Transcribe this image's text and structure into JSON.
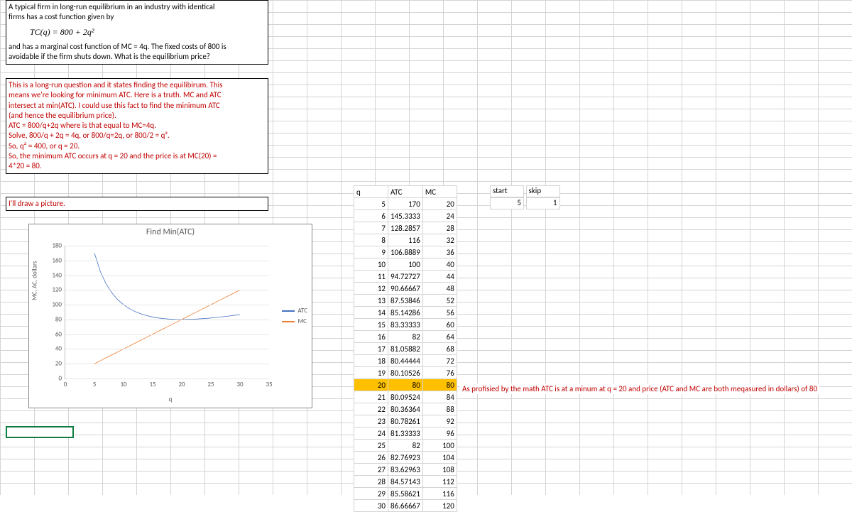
{
  "problem": {
    "line1": "A typical firm in long-run equilibrium in an industry with identical",
    "line2": "firms has a cost function given by",
    "formula": "TC(q) = 800 + 2q²",
    "line3": "and has a marginal cost function of MC = 4q. The fixed costs of 800 is",
    "line4": "avoidable if the firm shuts down. What is the equilibrium price?"
  },
  "solution": {
    "l1": "This is a long-run question and it states finding the equilibirum. This",
    "l2": "means we're looking for minimum ATC. Here is a truth. MC and ATC",
    "l3": "intersect at min(ATC). I could use this fact to find the minimum ATC",
    "l4": "(and hence the equilibrium price).",
    "l5": "ATC = 800/q+2q where is that equal to MC=4q.",
    "l6": "Solve, 800/q + 2q = 4q, or 800/q=2q, or 800/2 = q².",
    "l7": "So, q² = 400, or q = 20.",
    "l8": "So, the minimum ATC occurs at q = 20 and the price is at MC(20) =",
    "l9": "4*20 = 80."
  },
  "picture_note": "I'll draw a picture.",
  "annotation": "As profisied by the math ATC is at a minum at q = 20 and price (ATC and MC are both meqasured in dollars) of 80",
  "chart_title": "Find Min(ATC)",
  "legend": {
    "atc": "ATC",
    "mc": "MC"
  },
  "axes": {
    "y": "MC, AC, dollars",
    "x": "q"
  },
  "headers": {
    "q": "q",
    "atc": "ATC",
    "mc": "MC",
    "start": "start",
    "skip": "skip"
  },
  "start_val": "5",
  "skip_val": "1",
  "highlight_q": 20,
  "colors": {
    "atc": "#4472c4",
    "mc": "#ed7d31",
    "highlight": "#ffc000",
    "solution_text": "#c00000"
  },
  "table_rows": [
    {
      "q": 5,
      "atc": "170",
      "mc": 20
    },
    {
      "q": 6,
      "atc": "145.3333",
      "mc": 24
    },
    {
      "q": 7,
      "atc": "128.2857",
      "mc": 28
    },
    {
      "q": 8,
      "atc": "116",
      "mc": 32
    },
    {
      "q": 9,
      "atc": "106.8889",
      "mc": 36
    },
    {
      "q": 10,
      "atc": "100",
      "mc": 40
    },
    {
      "q": 11,
      "atc": "94.72727",
      "mc": 44
    },
    {
      "q": 12,
      "atc": "90.66667",
      "mc": 48
    },
    {
      "q": 13,
      "atc": "87.53846",
      "mc": 52
    },
    {
      "q": 14,
      "atc": "85.14286",
      "mc": 56
    },
    {
      "q": 15,
      "atc": "83.33333",
      "mc": 60
    },
    {
      "q": 16,
      "atc": "82",
      "mc": 64
    },
    {
      "q": 17,
      "atc": "81.05882",
      "mc": 68
    },
    {
      "q": 18,
      "atc": "80.44444",
      "mc": 72
    },
    {
      "q": 19,
      "atc": "80.10526",
      "mc": 76
    },
    {
      "q": 20,
      "atc": "80",
      "mc": 80
    },
    {
      "q": 21,
      "atc": "80.09524",
      "mc": 84
    },
    {
      "q": 22,
      "atc": "80.36364",
      "mc": 88
    },
    {
      "q": 23,
      "atc": "80.78261",
      "mc": 92
    },
    {
      "q": 24,
      "atc": "81.33333",
      "mc": 96
    },
    {
      "q": 25,
      "atc": "82",
      "mc": 100
    },
    {
      "q": 26,
      "atc": "82.76923",
      "mc": 104
    },
    {
      "q": 27,
      "atc": "83.62963",
      "mc": 108
    },
    {
      "q": 28,
      "atc": "84.57143",
      "mc": 112
    },
    {
      "q": 29,
      "atc": "85.58621",
      "mc": 116
    },
    {
      "q": 30,
      "atc": "86.66667",
      "mc": 120
    }
  ],
  "chart_data": {
    "type": "line",
    "title": "Find Min(ATC)",
    "xlabel": "q",
    "ylabel": "MC, AC, dollars",
    "xlim": [
      0,
      35
    ],
    "ylim": [
      0,
      180
    ],
    "x_ticks": [
      0,
      5,
      10,
      15,
      20,
      25,
      30,
      35
    ],
    "y_ticks": [
      0,
      20,
      40,
      60,
      80,
      100,
      120,
      140,
      160,
      180
    ],
    "x": [
      5,
      6,
      7,
      8,
      9,
      10,
      11,
      12,
      13,
      14,
      15,
      16,
      17,
      18,
      19,
      20,
      21,
      22,
      23,
      24,
      25,
      26,
      27,
      28,
      29,
      30
    ],
    "series": [
      {
        "name": "ATC",
        "color": "#4472c4",
        "values": [
          170,
          145.33,
          128.29,
          116,
          106.89,
          100,
          94.73,
          90.67,
          87.54,
          85.14,
          83.33,
          82,
          81.06,
          80.44,
          80.11,
          80,
          80.1,
          80.36,
          80.78,
          81.33,
          82,
          82.77,
          83.63,
          84.57,
          85.59,
          86.67
        ]
      },
      {
        "name": "MC",
        "color": "#ed7d31",
        "values": [
          20,
          24,
          28,
          32,
          36,
          40,
          44,
          48,
          52,
          56,
          60,
          64,
          68,
          72,
          76,
          80,
          84,
          88,
          92,
          96,
          100,
          104,
          108,
          112,
          116,
          120
        ]
      }
    ]
  }
}
